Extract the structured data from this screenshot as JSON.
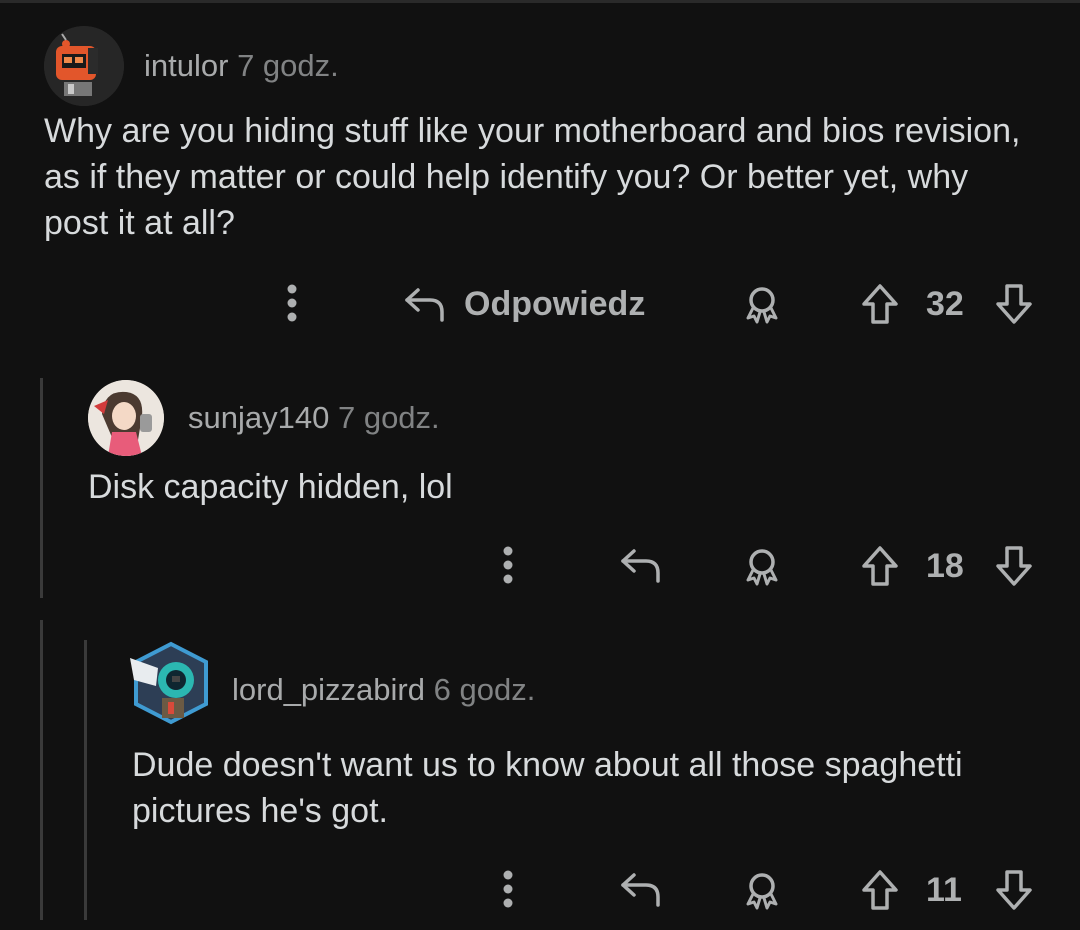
{
  "comments": [
    {
      "username": "intulor",
      "time": "7 godz.",
      "body": "Why are you hiding stuff like your motherboard and bios revision, as if they matter or could help identify you?  Or better yet, why post it at all?",
      "reply_label": "Odpowiedz",
      "score": "32",
      "avatar_icon": "robot-avatar-icon"
    },
    {
      "username": "sunjay140",
      "time": "7 godz.",
      "body": "Disk capacity hidden, lol",
      "reply_label": "",
      "score": "18",
      "avatar_icon": "anime-girl-avatar-icon"
    },
    {
      "username": "lord_pizzabird",
      "time": "6 godz.",
      "body": "Dude doesn't want us to know about all those spaghetti pictures he's got.",
      "reply_label": "",
      "score": "11",
      "avatar_icon": "robot-hexagon-avatar-icon"
    }
  ],
  "colors": {
    "background": "#111111",
    "text": "#d7dadc",
    "meta": "#818384",
    "icon": "#aeb0b1",
    "thread_line": "#3a3a3a"
  }
}
